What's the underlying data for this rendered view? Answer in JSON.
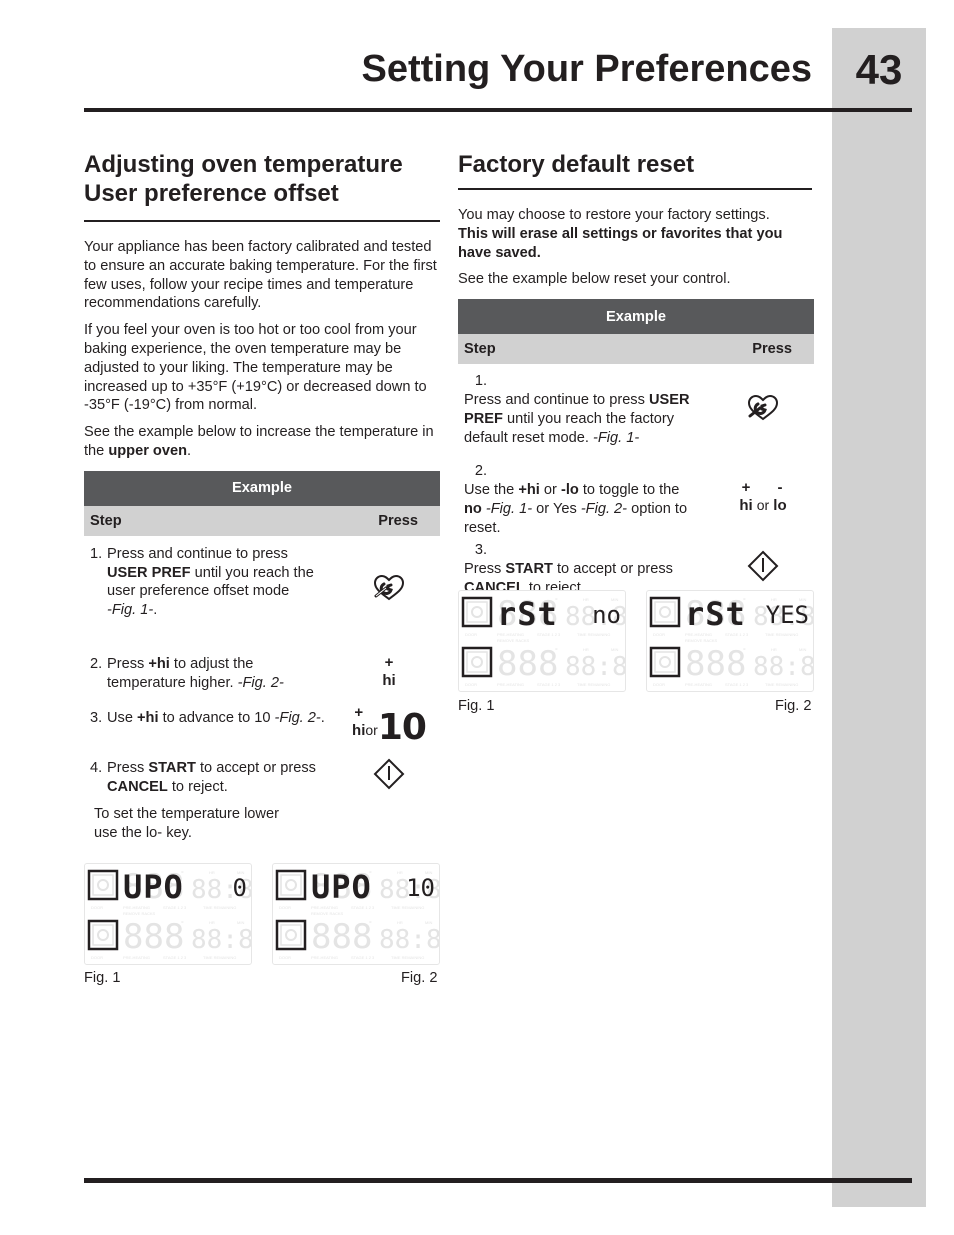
{
  "page": {
    "title": "Setting Your Preferences",
    "number": "43"
  },
  "left": {
    "heading_line1": "Adjusting oven temperature",
    "heading_line2": "User preference offset",
    "para1": "Your appliance has been factory calibrated and tested to ensure an accurate baking temperature. For the first few uses, follow your recipe times and temperature recommendations carefully.",
    "para2": "If you feel your oven is too hot or too cool from your baking experience, the oven temperature may be adjusted to your liking. The temperature may be increased  up to +35°F (+19°C) or decreased down to -35°F (-19°C) from normal.",
    "para3_pre": "See the example below to increase the temperature in the ",
    "para3_bold": "upper oven",
    "para3_post": ".",
    "table": {
      "title": "Example",
      "col_step": "Step",
      "col_press": "Press",
      "steps": [
        {
          "num": "1.",
          "t1": "Press and continue to press ",
          "b1": "USER PREF",
          "t2": " until you reach the user preference offset mode",
          "i1": "-Fig. 1-",
          "t3": ".",
          "icon": "user-pref-wrench-heart"
        },
        {
          "num": "2.",
          "t1": "Press ",
          "b1": "+hi",
          "t2": " to adjust the temperature higher. ",
          "i1": "-Fig. 2-",
          "t3": "",
          "icon": "hi-key",
          "plus": "+",
          "key": "hi"
        },
        {
          "num": "3.",
          "t1": "Use ",
          "b1": "+hi",
          "t2": " to advance to 10 ",
          "i1": "-Fig. 2-",
          "t3": ".",
          "icon": "hi-or-10",
          "plus": "+",
          "key": "hi",
          "or": "or",
          "value": "10"
        },
        {
          "num": "4.",
          "t1": "Press ",
          "b1": "START",
          "t2": " to accept or press ",
          "b2": "CANCEL",
          "t3": " to reject.",
          "icon": "start-diamond"
        }
      ],
      "note": "To set the temperature lower use the lo- key."
    },
    "figures": [
      {
        "label": "Fig. 1",
        "top_text": "UPO",
        "top_value": "0"
      },
      {
        "label": "Fig. 2",
        "top_text": "UPO",
        "top_value": "10"
      }
    ]
  },
  "right": {
    "heading": "Factory default reset",
    "para1": "You may choose to restore your factory settings.",
    "para1_bold": "This will erase all settings or favorites that you have saved.",
    "para2": "See the example below reset your control.",
    "table": {
      "title": "Example",
      "col_step": "Step",
      "col_press": "Press",
      "steps": [
        {
          "num": "1.",
          "t1": "Press and continue to press ",
          "b1": "USER PREF",
          "t2": " until you reach the factory default reset mode. ",
          "i1": "-Fig. 1-",
          "icon": "user-pref-wrench-heart"
        },
        {
          "num": "2.",
          "t1": "Use the ",
          "b1": "+hi",
          "t2": " or ",
          "b2": "-lo",
          "t3": " to toggle to the ",
          "b3": "no",
          "i1": " -Fig. 1-",
          "t4": " or Yes ",
          "i2": "-Fig. 2-",
          "t5": " option to reset.",
          "icon": "hi-or-lo",
          "plus": "+",
          "minus": "-",
          "key_hi": "hi",
          "or": "or",
          "key_lo": "lo"
        },
        {
          "num": "3.",
          "t1": "Press ",
          "b1": "START",
          "t2": " to accept or press ",
          "b2": "CANCEL",
          "t3": " to reject.",
          "icon": "start-diamond"
        }
      ]
    },
    "figures": [
      {
        "label": "Fig. 1",
        "top_text": "rSt",
        "top_value": "no"
      },
      {
        "label": "Fig. 2",
        "top_text": "rSt",
        "top_value": "YES"
      }
    ]
  },
  "lcd_labels": {
    "door": "DOOR",
    "preheating": "PRE-HEATING",
    "stage": "STAGE 1 2 3",
    "time_remaining": "TIME REMAINING",
    "remove_racks": "REMOVE RACKS",
    "hr": "HR",
    "min": "MIN",
    "ghost_temp": "888",
    "ghost_time": "88:88"
  }
}
